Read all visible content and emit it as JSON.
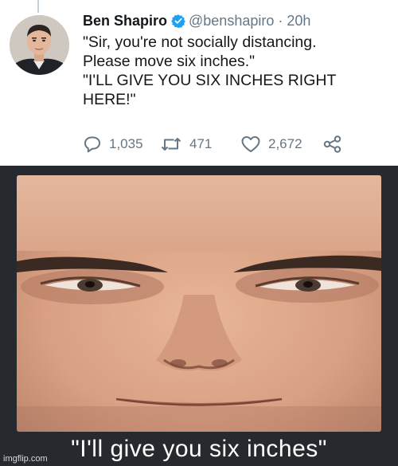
{
  "tweet": {
    "author_name": "Ben Shapiro",
    "handle": "@benshapiro",
    "separator": "·",
    "time": "20h",
    "lines": [
      "\"Sir, you're not socially distancing.",
      "Please move six inches.\"",
      "\"I'LL GIVE YOU SIX INCHES RIGHT",
      "HERE!\""
    ],
    "stats": {
      "replies": "1,035",
      "retweets": "471",
      "likes": "2,672"
    },
    "verified_color": "#1da1f2"
  },
  "meme": {
    "caption": "\"I'll give you six inches\"",
    "watermark": "imgflip.com"
  }
}
